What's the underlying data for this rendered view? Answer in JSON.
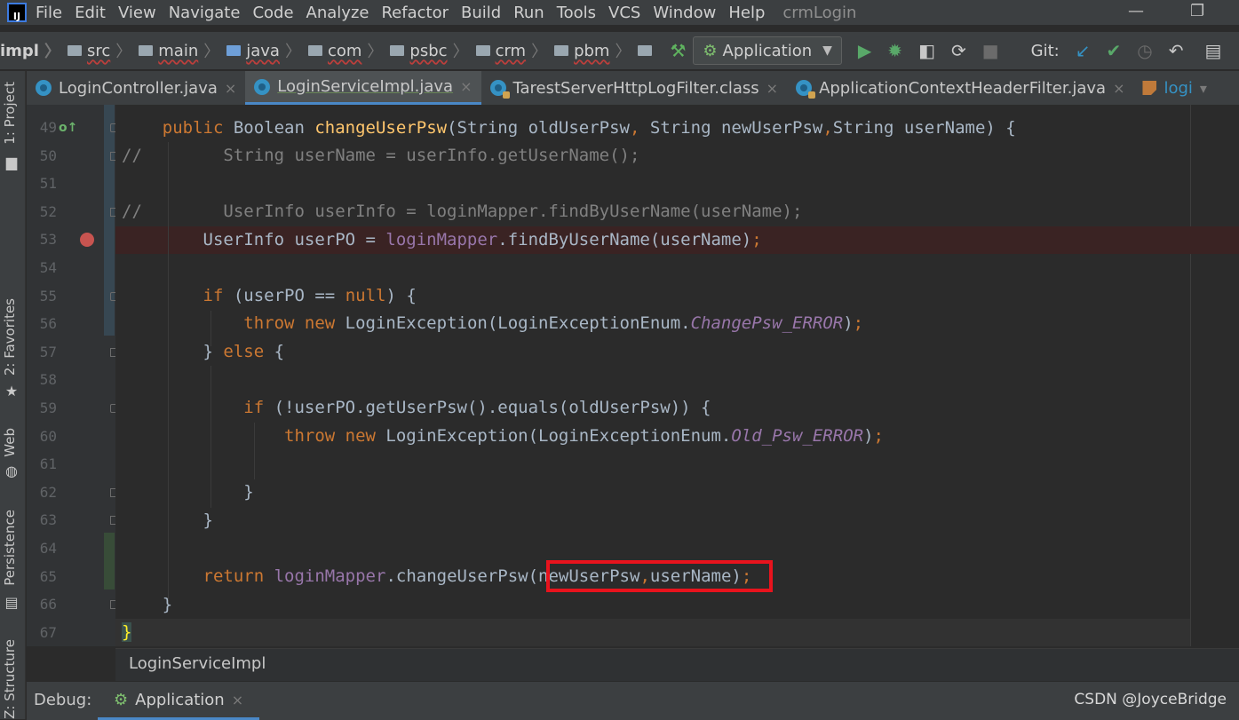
{
  "menubar": {
    "logo": "IJ",
    "items": [
      "File",
      "Edit",
      "View",
      "Navigate",
      "Code",
      "Analyze",
      "Refactor",
      "Build",
      "Run",
      "Tools",
      "VCS",
      "Window",
      "Help"
    ],
    "project": "crmLogin",
    "minimize": "—",
    "restore": "❐"
  },
  "navbar": {
    "breadcrumbs": [
      "impl",
      "src",
      "main",
      "java",
      "com",
      "psbc",
      "crm",
      "pbm"
    ],
    "run_config": "Application",
    "git_label": "Git:"
  },
  "tabs": [
    {
      "label": "LoginController.java",
      "close": "×"
    },
    {
      "label": "LoginServiceImpl.java",
      "close": "×"
    },
    {
      "label": "TarestServerHttpLogFilter.class",
      "close": "×"
    },
    {
      "label": "ApplicationContextHeaderFilter.java",
      "close": "×"
    },
    {
      "label": "logi",
      "close": "▾"
    }
  ],
  "left_tools": {
    "project": "1: Project",
    "favorites": "2: Favorites",
    "web": "Web",
    "persistence": "Persistence",
    "structure": "Z: Structure"
  },
  "editor": {
    "line_numbers": [
      "49",
      "50",
      "51",
      "52",
      "53",
      "54",
      "55",
      "56",
      "57",
      "58",
      "59",
      "60",
      "61",
      "62",
      "63",
      "64",
      "65",
      "66",
      "67"
    ],
    "breadcrumb": "LoginServiceImpl",
    "override_marker": "o↑"
  },
  "debug": {
    "label": "Debug:",
    "tab": "Application",
    "close": "×"
  },
  "watermark": "CSDN @JoyceBridge"
}
